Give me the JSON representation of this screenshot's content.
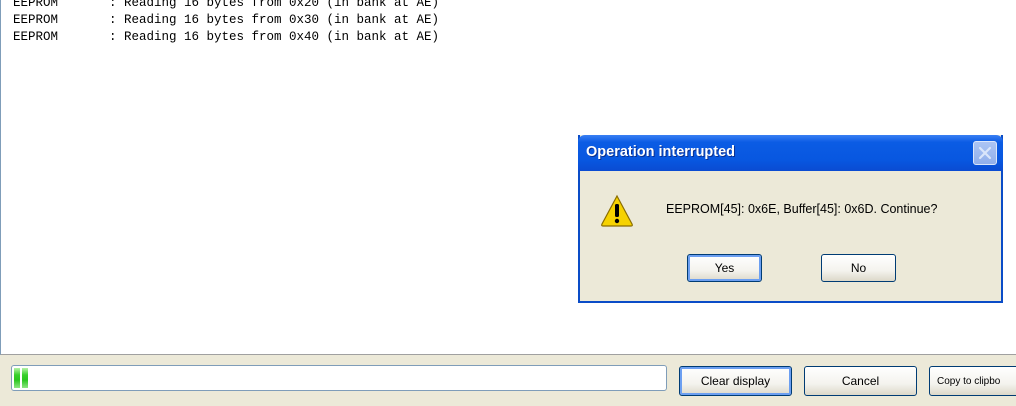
{
  "log": {
    "lines": [
      {
        "source": "EEPROM",
        "text": ": Reading 16 bytes from 0x20 (in bank at AE)"
      },
      {
        "source": "EEPROM",
        "text": ": Reading 16 bytes from 0x30 (in bank at AE)"
      },
      {
        "source": "EEPROM",
        "text": ": Reading 16 bytes from 0x40 (in bank at AE)"
      }
    ]
  },
  "progress": {
    "fraction": 0.02,
    "color": "#2ac61f"
  },
  "buttons": {
    "clear_display": "Clear display",
    "cancel": "Cancel",
    "copy": "Copy to clipbo"
  },
  "dialog": {
    "title": "Operation interrupted",
    "message": "EEPROM[45]: 0x6E, Buffer[45]: 0x6D.  Continue?",
    "icon": "warning-icon",
    "yes_label": "Yes",
    "no_label": "No"
  },
  "colors": {
    "titlebar": "#0857e0",
    "window_bg": "#ece9d8"
  }
}
